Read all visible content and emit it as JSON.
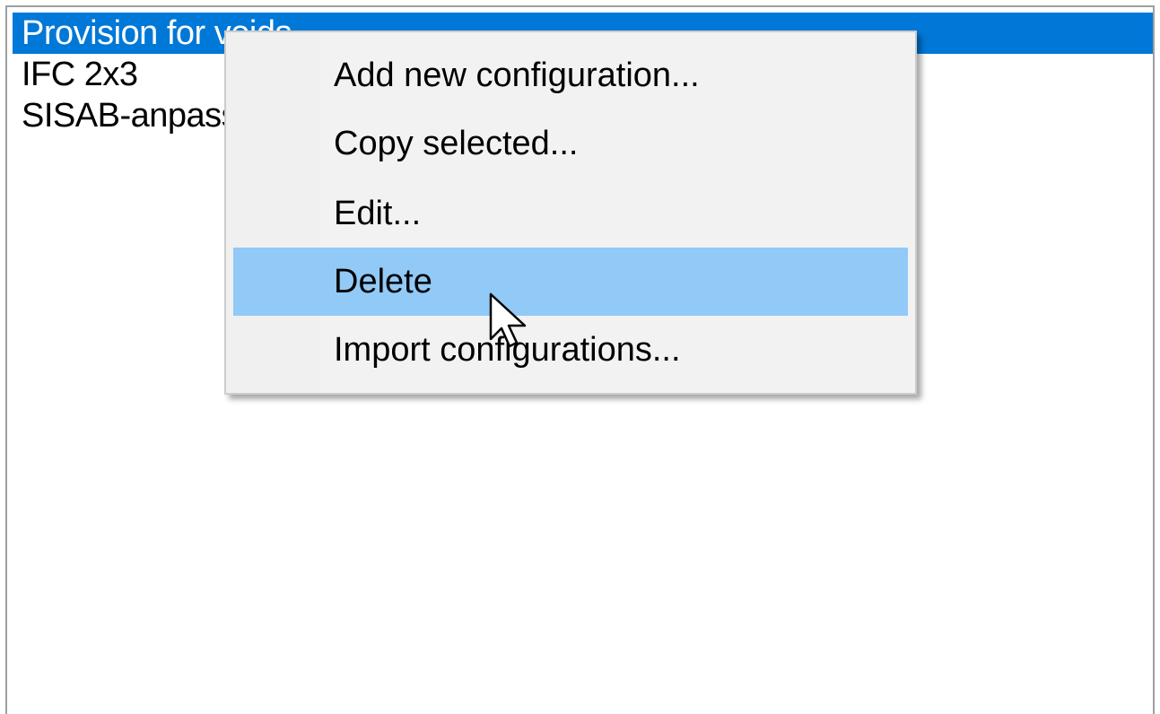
{
  "list": {
    "items": [
      {
        "label": "Provision for voids",
        "selected": true
      },
      {
        "label": "IFC 2x3",
        "selected": false
      },
      {
        "label": "SISAB-anpassad",
        "selected": false
      }
    ]
  },
  "context_menu": {
    "items": [
      {
        "label": "Add new configuration...",
        "hovered": false
      },
      {
        "label": "Copy selected...",
        "hovered": false
      },
      {
        "label": "Edit...",
        "hovered": false
      },
      {
        "label": "Delete",
        "hovered": true
      },
      {
        "label": "Import configurations...",
        "hovered": false
      }
    ]
  },
  "colors": {
    "selection": "#0078d7",
    "menu_hover": "#91c9f7",
    "menu_background": "#f2f2f2"
  },
  "icons": {
    "cursor": "arrow-cursor-icon"
  }
}
